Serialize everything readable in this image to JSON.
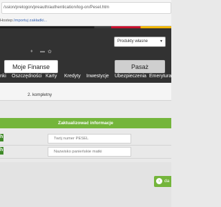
{
  "browser": {
    "url": "/ssion/prelogon/preauth/authentication/log-on/Pesel.htm",
    "bookmarks_prefix": "Hostep.",
    "bookmarks_import": "Importuj zakładki..."
  },
  "header": {
    "select_value": "Produkty własne",
    "moje_finanse": "Moje Finanse",
    "pasaz": "Pasaż",
    "icons": [
      "lightbulb-icon",
      "message-icon",
      "gear-icon"
    ]
  },
  "nav": {
    "items": [
      "nki",
      "Oszczędności",
      "Karty",
      "Kredyty",
      "Inwestycje",
      "Ubezpieczenia",
      "Emerytura"
    ]
  },
  "steps": {
    "label": "2. kompletny"
  },
  "form": {
    "title": "Zaktualizować informacje",
    "pesel_placeholder": "Twój numer PESEL",
    "maiden_placeholder": "Nazwisko panieńskie matki"
  },
  "footer": {
    "next_label": "da"
  },
  "colors": {
    "accent_green": "#74b53b",
    "banner": "#323232"
  }
}
